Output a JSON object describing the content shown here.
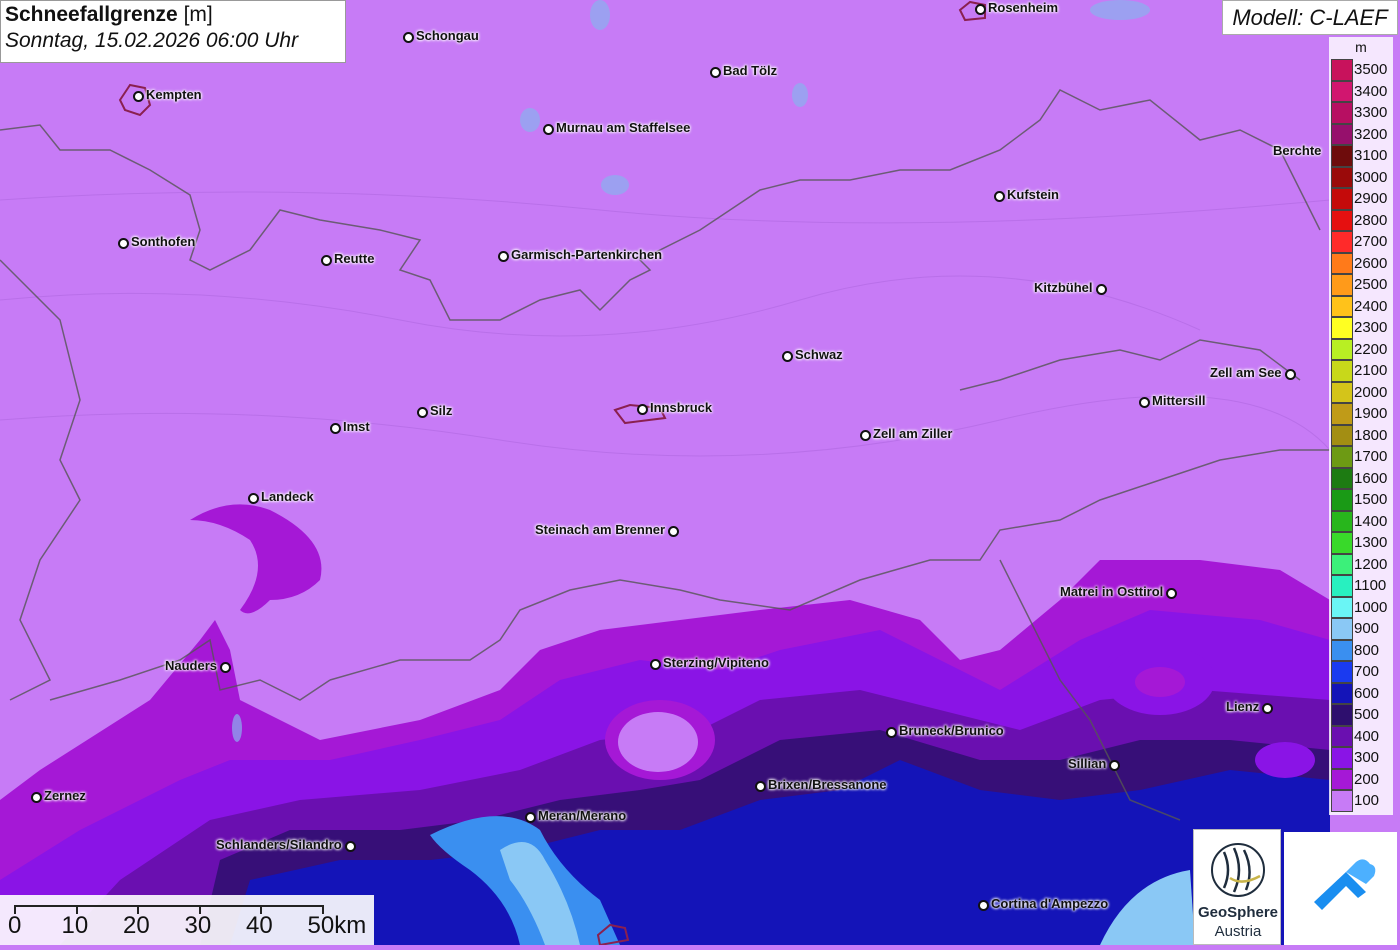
{
  "title": {
    "variable": "Schneefallgrenze",
    "unit": "[m]",
    "datetime": "Sonntag, 15.02.2026 06:00 Uhr"
  },
  "model": "Modell: C-LAEF",
  "legend": {
    "unit": "m",
    "levels": [
      {
        "label": "3500",
        "color": "#c8125c"
      },
      {
        "label": "3400",
        "color": "#d1166f"
      },
      {
        "label": "3300",
        "color": "#b70f62"
      },
      {
        "label": "3200",
        "color": "#96106c"
      },
      {
        "label": "3100",
        "color": "#6e0c0c"
      },
      {
        "label": "3000",
        "color": "#9a0a0a"
      },
      {
        "label": "2900",
        "color": "#c40a0a"
      },
      {
        "label": "2800",
        "color": "#e51010"
      },
      {
        "label": "2700",
        "color": "#ff2a2a"
      },
      {
        "label": "2600",
        "color": "#ff7a1a"
      },
      {
        "label": "2500",
        "color": "#ff9a1a"
      },
      {
        "label": "2400",
        "color": "#ffc21a"
      },
      {
        "label": "2300",
        "color": "#ffff22"
      },
      {
        "label": "2200",
        "color": "#b8ef23"
      },
      {
        "label": "2100",
        "color": "#c8d81a"
      },
      {
        "label": "2000",
        "color": "#d4c41a"
      },
      {
        "label": "1900",
        "color": "#c09b18"
      },
      {
        "label": "1800",
        "color": "#a38e13"
      },
      {
        "label": "1700",
        "color": "#6d9a14"
      },
      {
        "label": "1600",
        "color": "#1d7b12"
      },
      {
        "label": "1500",
        "color": "#1a9a16"
      },
      {
        "label": "1400",
        "color": "#28b61c"
      },
      {
        "label": "1300",
        "color": "#39d92a"
      },
      {
        "label": "1200",
        "color": "#3cf07a"
      },
      {
        "label": "1100",
        "color": "#28f0c0"
      },
      {
        "label": "1000",
        "color": "#6af5f5"
      },
      {
        "label": "900",
        "color": "#8ac8f5"
      },
      {
        "label": "800",
        "color": "#3a8ff0"
      },
      {
        "label": "700",
        "color": "#1a3af0"
      },
      {
        "label": "600",
        "color": "#1414b8"
      },
      {
        "label": "500",
        "color": "#2e0f6e"
      },
      {
        "label": "400",
        "color": "#6a0fb0"
      },
      {
        "label": "300",
        "color": "#8a14e6"
      },
      {
        "label": "200",
        "color": "#a518d6"
      },
      {
        "label": "100",
        "color": "#c77bf6"
      }
    ]
  },
  "cities": [
    {
      "name": "Rosenheim"
    },
    {
      "name": "Schongau"
    },
    {
      "name": "Kempten"
    },
    {
      "name": "Bad Tölz"
    },
    {
      "name": "Murnau am Staffelsee"
    },
    {
      "name": "Berchte"
    },
    {
      "name": "Kufstein"
    },
    {
      "name": "Sonthofen"
    },
    {
      "name": "Reutte"
    },
    {
      "name": "Garmisch-Partenkirchen"
    },
    {
      "name": "Kitzbühel"
    },
    {
      "name": "Schwaz"
    },
    {
      "name": "Zell am See"
    },
    {
      "name": "Mittersill"
    },
    {
      "name": "Silz"
    },
    {
      "name": "Innsbruck"
    },
    {
      "name": "Imst"
    },
    {
      "name": "Zell am Ziller"
    },
    {
      "name": "Landeck"
    },
    {
      "name": "Steinach am Brenner"
    },
    {
      "name": "Matrei in Osttirol"
    },
    {
      "name": "Nauders"
    },
    {
      "name": "Sterzing/Vipiteno"
    },
    {
      "name": "Lienz"
    },
    {
      "name": "Bruneck/Brunico"
    },
    {
      "name": "Sillian"
    },
    {
      "name": "Zernez"
    },
    {
      "name": "Brixen/Bressanone"
    },
    {
      "name": "Meran/Merano"
    },
    {
      "name": "Schlanders/Silandro"
    },
    {
      "name": "Cortina d'Ampezzo"
    }
  ],
  "scale_bar": {
    "labels": [
      "0",
      "10",
      "20",
      "30",
      "40",
      "50km"
    ]
  },
  "logos": {
    "geosphere_name": "GeoSphere",
    "geosphere_sub": "Austria"
  }
}
